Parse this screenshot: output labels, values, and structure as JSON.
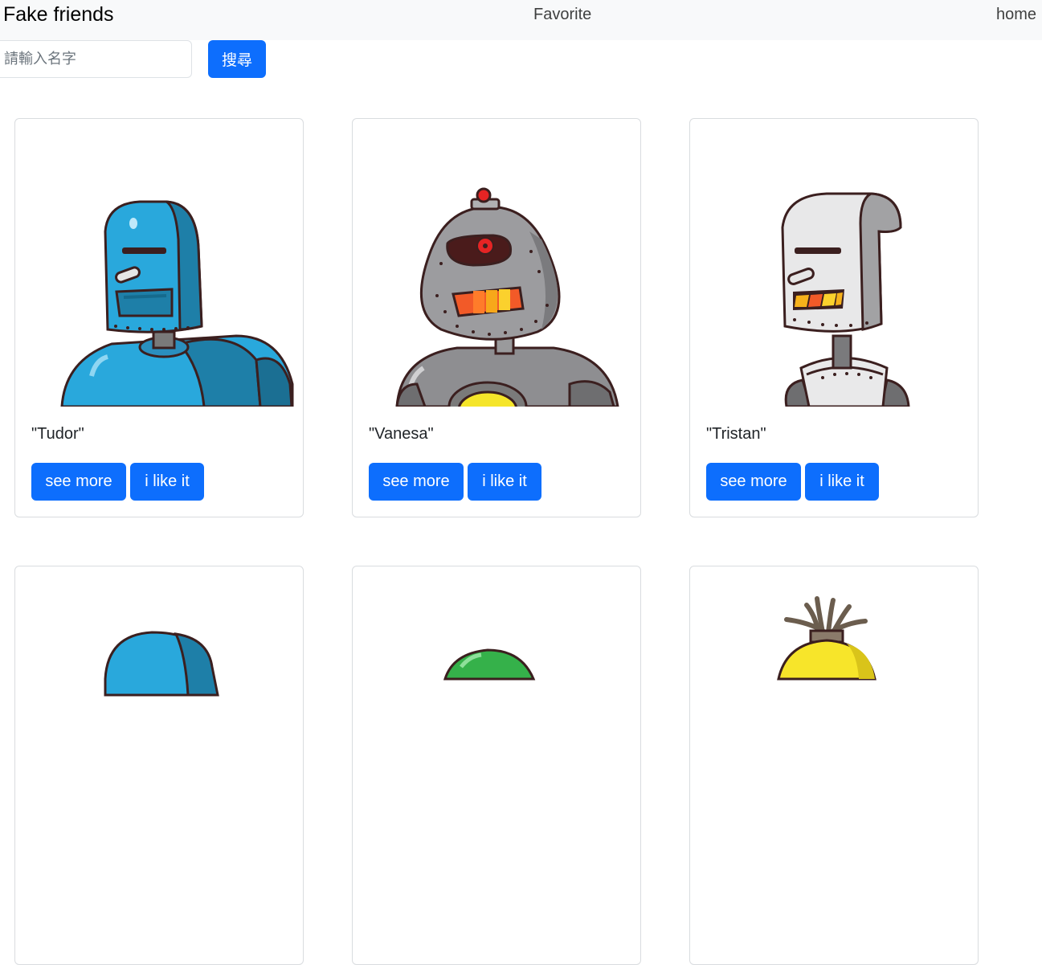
{
  "navbar": {
    "brand": "Fake friends",
    "favorite": "Favorite",
    "home": "home"
  },
  "search": {
    "placeholder": "請輸入名字",
    "value": "",
    "button_label": "搜尋"
  },
  "cards": [
    {
      "name": "\"Tudor\"",
      "see_more": "see more",
      "like": "i like it",
      "robot": "blue-robot"
    },
    {
      "name": "\"Vanesa\"",
      "see_more": "see more",
      "like": "i like it",
      "robot": "gray-robot"
    },
    {
      "name": "\"Tristan\"",
      "see_more": "see more",
      "like": "i like it",
      "robot": "white-robot"
    },
    {
      "name": "",
      "see_more": "",
      "like": "",
      "robot": "blue-robot"
    },
    {
      "name": "",
      "see_more": "",
      "like": "",
      "robot": "green-robot"
    },
    {
      "name": "",
      "see_more": "",
      "like": "",
      "robot": "yellow-robot"
    }
  ],
  "colors": {
    "primary": "#0d6efd",
    "navbar_bg": "#f8f9fa",
    "card_border": "#d9dcdf"
  }
}
